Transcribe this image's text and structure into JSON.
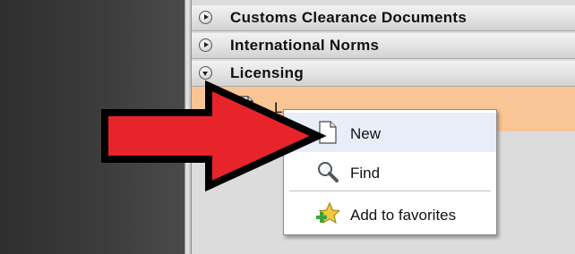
{
  "sections": [
    {
      "title": "Customs Clearance Documents",
      "expanded": false
    },
    {
      "title": "International Norms",
      "expanded": false
    },
    {
      "title": "Licensing",
      "expanded": true
    }
  ],
  "selected_row": {
    "label": "L",
    "icon": "document-icon"
  },
  "context_menu": {
    "items": [
      {
        "label": "New",
        "icon": "new-document-icon",
        "highlighted": true
      },
      {
        "label": "Find",
        "icon": "magnifier-icon",
        "highlighted": false
      },
      {
        "label": "Add to favorites",
        "icon": "star-plus-icon",
        "highlighted": false
      }
    ]
  },
  "colors": {
    "arrow_fill": "#e8242b",
    "selected_row": "#f9c594",
    "menu_highlight": "#e8eef8"
  }
}
